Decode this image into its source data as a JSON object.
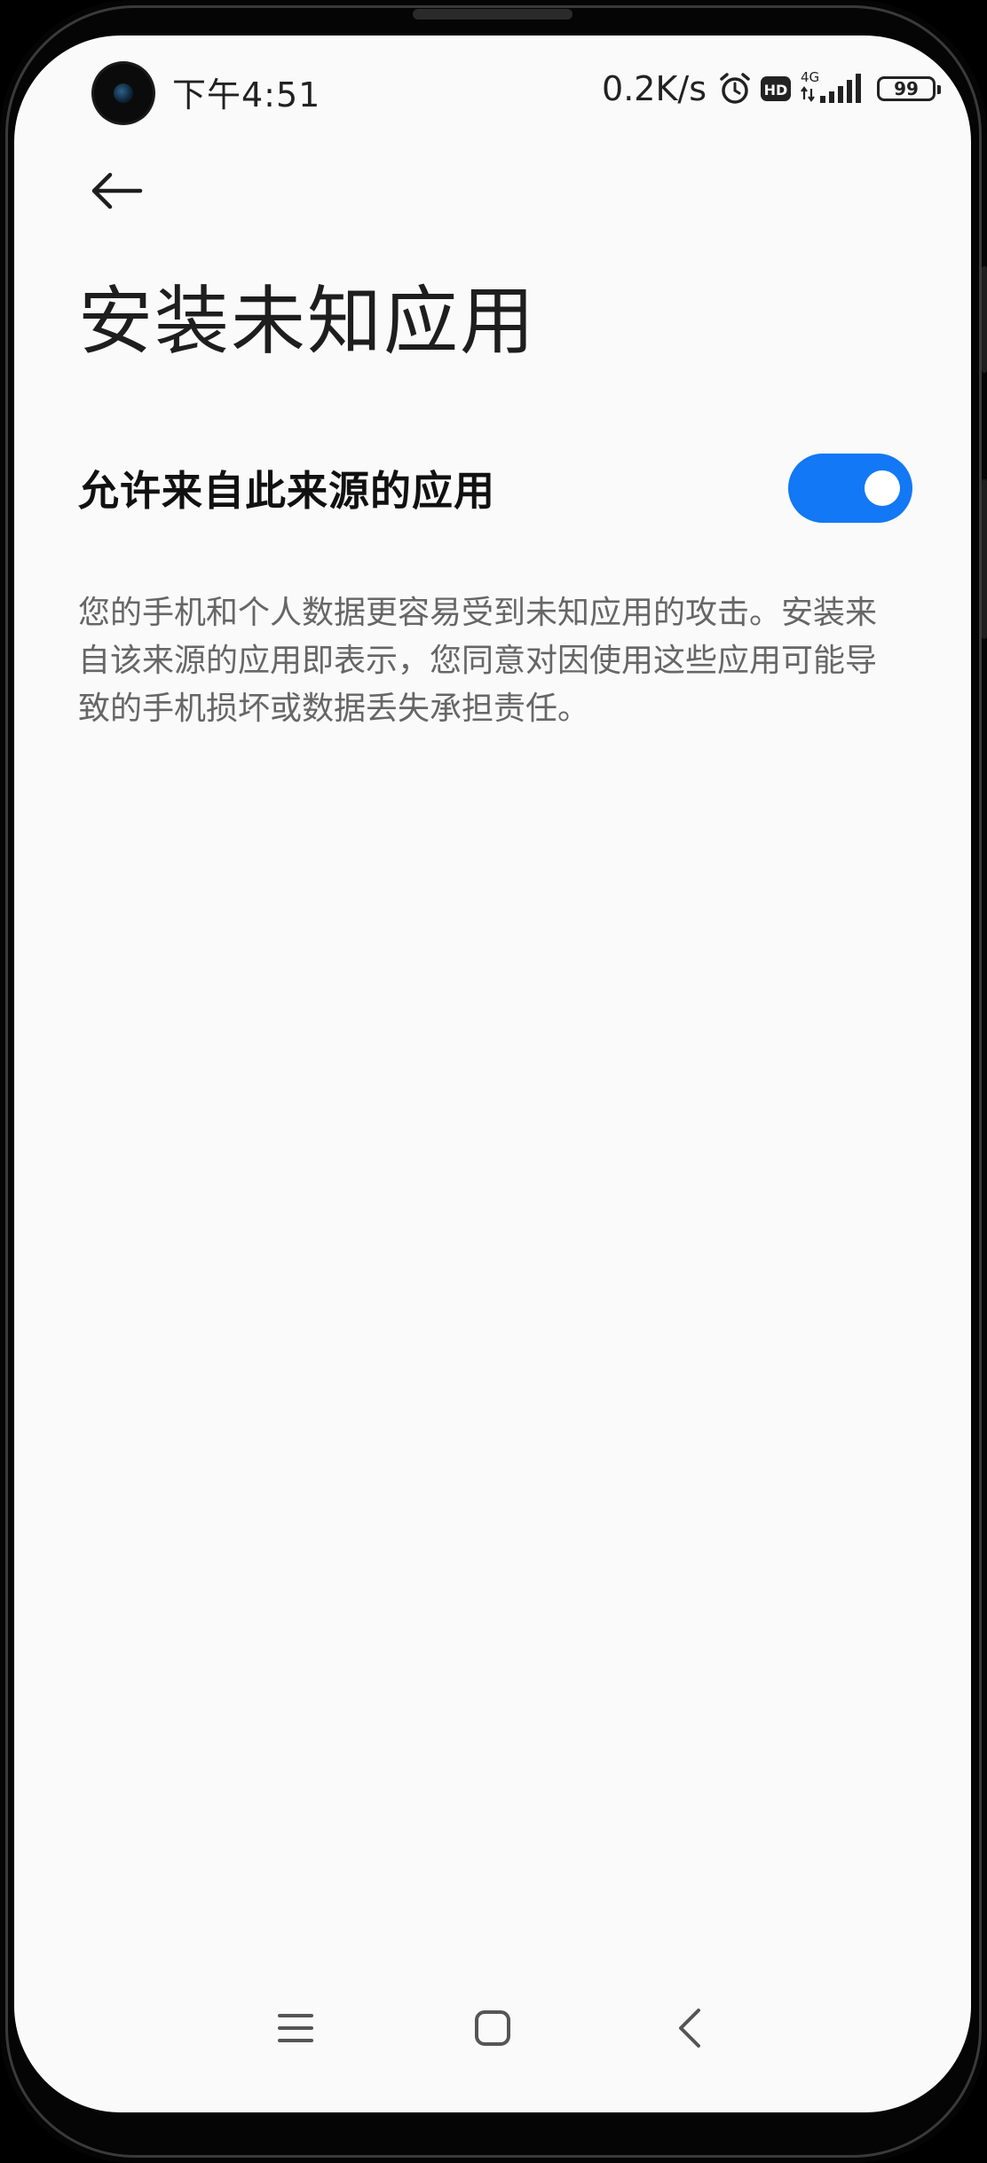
{
  "status_bar": {
    "time": "下午4:51",
    "net_speed": "0.2K/s",
    "hd_badge": "HD",
    "network_type": "4G",
    "battery_level": "99",
    "icons": [
      "alarm-icon",
      "hd-voice-icon",
      "signal-icon",
      "battery-icon"
    ]
  },
  "header": {
    "back_icon": "arrow-left-icon",
    "title": "安装未知应用"
  },
  "setting": {
    "label": "允许来自此来源的应用",
    "enabled": true
  },
  "warning": {
    "text": "您的手机和个人数据更容易受到未知应用的攻击。安装来自该来源的应用即表示，您同意对因使用这些应用可能导致的手机损坏或数据丢失承担责任。"
  },
  "nav_bar": {
    "items": [
      "menu-icon",
      "home-icon",
      "back-icon"
    ]
  },
  "colors": {
    "accent": "#1278f5",
    "background": "#fafafa",
    "title": "#1e1e1e",
    "secondary_text": "#666666"
  }
}
